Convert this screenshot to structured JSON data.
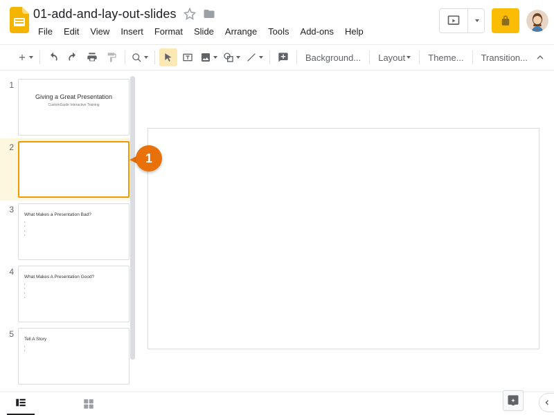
{
  "doc": {
    "title": "01-add-and-lay-out-slides"
  },
  "menus": {
    "file": "File",
    "edit": "Edit",
    "view": "View",
    "insert": "Insert",
    "format": "Format",
    "slide": "Slide",
    "arrange": "Arrange",
    "tools": "Tools",
    "addons": "Add-ons",
    "help": "Help"
  },
  "toolbar": {
    "background": "Background...",
    "layout": "Layout",
    "theme": "Theme...",
    "transition": "Transition..."
  },
  "icons": {
    "star": "star-outline",
    "folder": "folder-move",
    "present": "present",
    "share": "share-lock",
    "new_slide": "plus",
    "undo": "undo",
    "redo": "redo",
    "print": "print",
    "paint": "paint-format",
    "zoom": "zoom",
    "select": "cursor",
    "textbox": "text-box",
    "image": "image",
    "shape": "shape",
    "line": "line",
    "comment": "add-comment",
    "chevron_up": "chevron-up",
    "filmstrip": "filmstrip-view",
    "grid": "grid-view",
    "explore": "explore",
    "side_toggle": "chevron-left"
  },
  "callout": {
    "number": "1"
  },
  "slides": [
    {
      "num": "1",
      "selected": false,
      "layout": "title",
      "title": "Giving a Great Presentation",
      "subtitle": "CustomGuide Interactive Training"
    },
    {
      "num": "2",
      "selected": true,
      "layout": "blank"
    },
    {
      "num": "3",
      "selected": false,
      "layout": "bullets",
      "heading": "What Makes a Presentation Bad?",
      "bullets": [
        "",
        "",
        "",
        ""
      ]
    },
    {
      "num": "4",
      "selected": false,
      "layout": "bullets",
      "heading": "What Makes A Presentation Good?",
      "bullets": [
        "",
        "",
        "",
        ""
      ]
    },
    {
      "num": "5",
      "selected": false,
      "layout": "bullets",
      "heading": "Tell A Story",
      "bullets": [
        "",
        ""
      ]
    }
  ],
  "colors": {
    "accent": "#f29900",
    "callout": "#e8710a",
    "share": "#fbbc04"
  }
}
